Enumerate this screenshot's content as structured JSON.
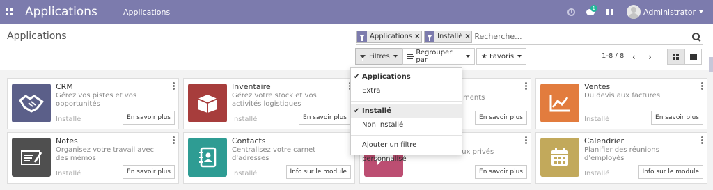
{
  "navbar": {
    "app_title": "Applications",
    "menu_item": "Applications",
    "notification_count": "1",
    "user_name": "Administrator",
    "color": "#7C7BAD"
  },
  "control_panel": {
    "title": "Applications",
    "facets": [
      {
        "value": "Applications"
      },
      {
        "value": "Installé"
      }
    ],
    "search_placeholder": "Recherche...",
    "filters_label": "Filtres",
    "group_by_label": "Regrouper par",
    "favorites_label": "Favoris",
    "pager": "1-8 / 8"
  },
  "filter_menu": {
    "items": [
      {
        "label": "Applications",
        "checked": true
      },
      {
        "label": "Extra",
        "checked": false
      },
      {
        "label": "Installé",
        "checked": true
      },
      {
        "label": "Non installé",
        "checked": false
      },
      {
        "label": "Ajouter un filtre personnalisé",
        "checked": false
      }
    ]
  },
  "apps": [
    {
      "name": "CRM",
      "description": "Gérez vos pistes et vos opportunités",
      "status": "Installé",
      "button": "En savoir plus",
      "icon": "handshake-icon",
      "color": "#5b5f89"
    },
    {
      "name": "Inventaire",
      "description": "Gérez votre stock et vos activités logistiques",
      "status": "Installé",
      "button": "En savoir plus",
      "icon": "box-icon",
      "color": "#a73d3c"
    },
    {
      "name": "",
      "description": "ments",
      "status": "",
      "button": "En savoir plus",
      "icon": "",
      "color": "#ffffff"
    },
    {
      "name": "Ventes",
      "description": "Du devis aux factures",
      "status": "Installé",
      "button": "En savoir plus",
      "icon": "chart-icon",
      "color": "#e27c3e"
    },
    {
      "name": "Notes",
      "description": "Organisez votre travail avec des mémos",
      "status": "Installé",
      "button": "En savoir plus",
      "icon": "note-icon",
      "color": "#4f4f4f"
    },
    {
      "name": "Contacts",
      "description": "Centralisez votre carnet d'adresses",
      "status": "Installé",
      "button": "Info sur le module",
      "icon": "address-book-icon",
      "color": "#2e9c93"
    },
    {
      "name": "",
      "description": "d'email et canaux privés",
      "status": "",
      "button": "En savoir plus",
      "icon": "chat-icon",
      "color": "#bc4e72"
    },
    {
      "name": "Calendrier",
      "description": "Planifier des réunions d'employés",
      "status": "Installé",
      "button": "Info sur le module",
      "icon": "calendar-icon",
      "color": "#c2a95b"
    }
  ]
}
